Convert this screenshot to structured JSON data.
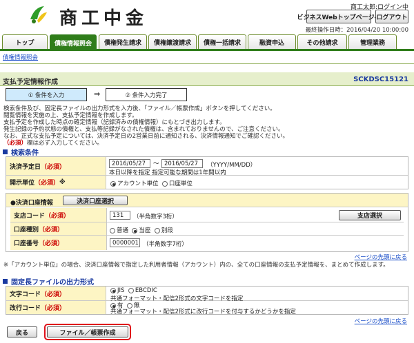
{
  "header": {
    "brand": "商工中金",
    "user_name": "商工太郎:ログイン中",
    "business_web_top_button": "ビジネスWebトップページへ",
    "logout_button": "ログアウト",
    "last_operation": "最終操作日時：2016/04/20 10:00:00"
  },
  "tabs": [
    {
      "label": "トップ"
    },
    {
      "label": "債権情報照会"
    },
    {
      "label": "債権発生請求"
    },
    {
      "label": "債権譲渡請求"
    },
    {
      "label": "債権一括請求"
    },
    {
      "label": "融資申込"
    },
    {
      "label": "その他請求"
    },
    {
      "label": "管理業務"
    }
  ],
  "breadcrumb": "債権情報照会",
  "page": {
    "title": "支払予定情報作成",
    "screen_id": "SCKDSC15121"
  },
  "steps": {
    "step1": "① 条件を入力",
    "arrow": "⇒",
    "step2": "② 条件入力完了"
  },
  "description": {
    "line1": "検索条件及び、固定長ファイルの出力形式を入力後、「ファイル／帳票作成」ボタンを押してください。",
    "line2": "閲覧情報を実施の上、支払予定情報を作成します。",
    "line3": "支払予定を作成した時点の確定情報（記録済みの債権情報）にもとづき出力します。",
    "line4": "発生記録の予約状態の債権と、支払等記録がなされた債権は、含まれておりませんので、ご注意ください。",
    "line5": "なお、正式な支払予定については、決済予定日の2営業日前に通知される、決済情報通知でご確認ください。",
    "required_mark": "（必須）",
    "line6_rest": "欄は必ず入力してください。"
  },
  "search_section": {
    "heading": "検索条件",
    "settlement_date_label": "決済予定日",
    "required": "（必須）",
    "date_from": "2016/05/27",
    "tilde": "～",
    "date_to": "2016/05/27",
    "date_format": "（YYYY/MM/DD）",
    "date_note": "本日以降を指定 指定可能な期間は1年間以内",
    "disclosure_label": "開示単位",
    "disclosure_required": "（必須）",
    "disclosure_mark": "※",
    "opt_account": "アカウント単位",
    "opt_kouza": "口座単位",
    "settlement_account_info": "●決済口座情報",
    "select_account_button": "決済口座選択",
    "branch_code_label": "支店コード",
    "branch_code_value": "131",
    "branch_code_hint": "（半角数字3桁）",
    "branch_select_button": "支店選択",
    "account_type_label": "口座種別",
    "opt_futsu": "普通",
    "opt_touza": "当座",
    "opt_betsudan": "別段",
    "account_number_label": "口座番号",
    "account_number_value": "0000001",
    "account_number_hint": "（半角数字7桁）",
    "page_top_link": "ページの先頭に戻る",
    "footnote": "※「アカウント単位」の場合、決済口座情報で指定した利用者情報（アカウント）内の、全ての口座情報の支払予定情報を、まとめて作成します。"
  },
  "file_section": {
    "heading": "固定長ファイルの出力形式",
    "char_code_label": "文字コード",
    "required": "（必須）",
    "opt_jis": "JIS",
    "opt_ebcdic": "EBCDIC",
    "char_code_note": "共通フォーマット・配信2形式の文字コードを指定",
    "newline_label": "改行コード",
    "opt_yes": "有",
    "opt_no": "無",
    "newline_note": "共通フォーマット・配信2形式に改行コードを付与するかどうかを指定",
    "page_top_link": "ページの先頭に戻る"
  },
  "footer": {
    "back_button": "戻る",
    "create_button": "ファイル／帳票作成"
  },
  "colors": {
    "brand_green": "#2f7d1a",
    "label_bg": "#fdf5c4",
    "highlight_red": "#e0101a"
  }
}
